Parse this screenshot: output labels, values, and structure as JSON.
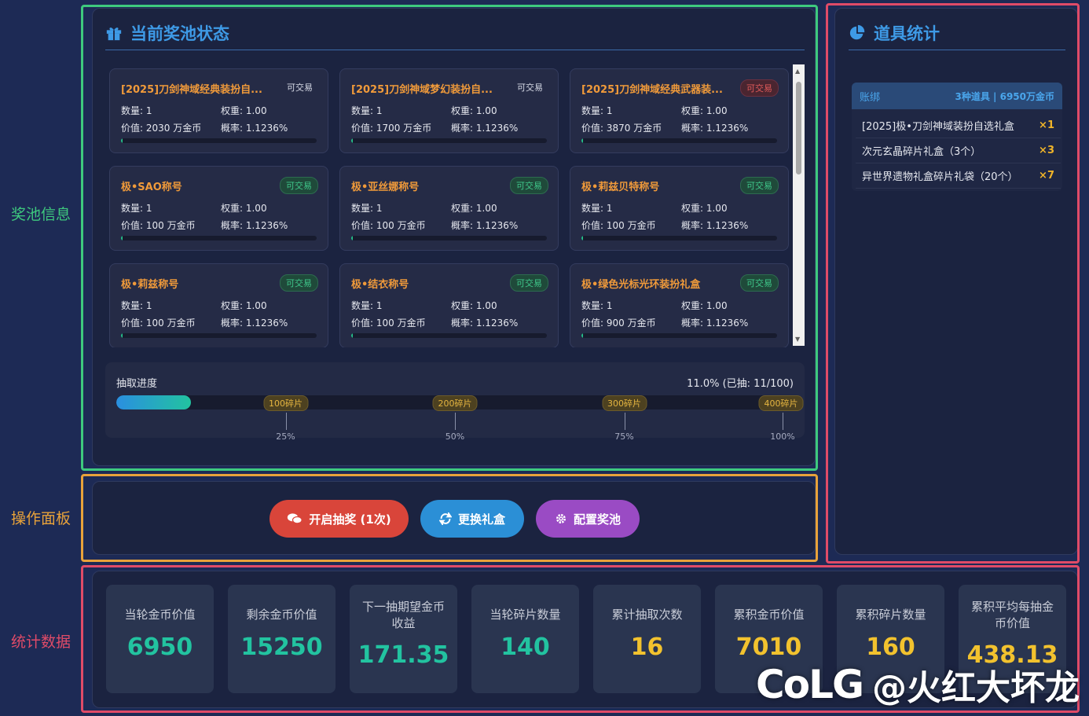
{
  "side_labels": {
    "pool_info": "奖池信息",
    "operations": "操作面板",
    "statistics": "统计数据"
  },
  "pool": {
    "title": "当前奖池状态",
    "icon": "gift-icon",
    "cards": [
      {
        "name": "[2025]刀剑神域经典装扮自...",
        "badge": "可交易",
        "badge_type": "gold",
        "qty_label": "数量: 1",
        "weight_label": "权重: 1.00",
        "value_label": "价值: 2030 万金币",
        "prob_label": "概率: 1.1236%",
        "fill": 0.01
      },
      {
        "name": "[2025]刀剑神域梦幻装扮自...",
        "badge": "可交易",
        "badge_type": "gold",
        "qty_label": "数量: 1",
        "weight_label": "权重: 1.00",
        "value_label": "价值: 1700 万金币",
        "prob_label": "概率: 1.1236%",
        "fill": 0.01
      },
      {
        "name": "[2025]刀剑神域经典武器装...",
        "badge": "可交易",
        "badge_type": "bind",
        "qty_label": "数量: 1",
        "weight_label": "权重: 1.00",
        "value_label": "价值: 3870 万金币",
        "prob_label": "概率: 1.1236%",
        "fill": 0.01
      },
      {
        "name": "极•SAO称号",
        "badge": "可交易",
        "badge_type": "trade",
        "qty_label": "数量: 1",
        "weight_label": "权重: 1.00",
        "value_label": "价值: 100 万金币",
        "prob_label": "概率: 1.1236%",
        "fill": 0.01
      },
      {
        "name": "极•亚丝娜称号",
        "badge": "可交易",
        "badge_type": "trade",
        "qty_label": "数量: 1",
        "weight_label": "权重: 1.00",
        "value_label": "价值: 100 万金币",
        "prob_label": "概率: 1.1236%",
        "fill": 0.01
      },
      {
        "name": "极•莉兹贝特称号",
        "badge": "可交易",
        "badge_type": "trade",
        "qty_label": "数量: 1",
        "weight_label": "权重: 1.00",
        "value_label": "价值: 100 万金币",
        "prob_label": "概率: 1.1236%",
        "fill": 0.01
      },
      {
        "name": "极•莉兹称号",
        "badge": "可交易",
        "badge_type": "trade",
        "qty_label": "数量: 1",
        "weight_label": "权重: 1.00",
        "value_label": "价值: 100 万金币",
        "prob_label": "概率: 1.1236%",
        "fill": 0.01
      },
      {
        "name": "极•结衣称号",
        "badge": "可交易",
        "badge_type": "trade",
        "qty_label": "数量: 1",
        "weight_label": "权重: 1.00",
        "value_label": "价值: 100 万金币",
        "prob_label": "概率: 1.1236%",
        "fill": 0.01
      },
      {
        "name": "极•绿色光标光环装扮礼盒",
        "badge": "可交易",
        "badge_type": "trade",
        "qty_label": "数量: 1",
        "weight_label": "权重: 1.00",
        "value_label": "价值: 900 万金币",
        "prob_label": "概率: 1.1236%",
        "fill": 0.01
      }
    ],
    "progress": {
      "label": "抽取进度",
      "summary": "11.0% (已抽: 11/100)",
      "fraction": 0.11,
      "milestones": [
        {
          "label": "100碎片",
          "at": 0.25
        },
        {
          "label": "200碎片",
          "at": 0.5
        },
        {
          "label": "300碎片",
          "at": 0.75
        },
        {
          "label": "400碎片",
          "at": 1.0
        }
      ],
      "ticks": [
        {
          "label": "25%",
          "at": 0.25
        },
        {
          "label": "50%",
          "at": 0.5
        },
        {
          "label": "75%",
          "at": 0.75
        },
        {
          "label": "100%",
          "at": 1.0
        }
      ]
    }
  },
  "operations": {
    "draw_label": "开启抽奖 (1次)",
    "swap_label": "更换礼盒",
    "config_label": "配置奖池"
  },
  "items": {
    "title": "道具统计",
    "icon": "pie-chart-icon",
    "group_label": "账绑",
    "group_summary": "3种道具 | 6950万金币",
    "rows": [
      {
        "name": "[2025]极•刀剑神域装扮自选礼盒",
        "count": "×1"
      },
      {
        "name": "次元玄晶碎片礼盒（3个）",
        "count": "×3"
      },
      {
        "name": "异世界遗物礼盒碎片礼袋（20个）",
        "count": "×7"
      }
    ]
  },
  "stats": [
    {
      "label": "当轮金币价值",
      "value": "6950",
      "color": "#22c3a0"
    },
    {
      "label": "剩余金币价值",
      "value": "15250",
      "color": "#22c3a0"
    },
    {
      "label": "下一抽期望金币收益",
      "value": "171.35",
      "color": "#22c3a0"
    },
    {
      "label": "当轮碎片数量",
      "value": "140",
      "color": "#22c3a0"
    },
    {
      "label": "累计抽取次数",
      "value": "16",
      "color": "#f2c22e"
    },
    {
      "label": "累积金币价值",
      "value": "7010",
      "color": "#f2c22e"
    },
    {
      "label": "累积碎片数量",
      "value": "160",
      "color": "#f2c22e"
    },
    {
      "label": "累积平均每抽金币价值",
      "value": "438.13",
      "color": "#f2c22e"
    }
  ],
  "watermark": {
    "logo": "CoLG",
    "handle": "@火红大坏龙"
  }
}
